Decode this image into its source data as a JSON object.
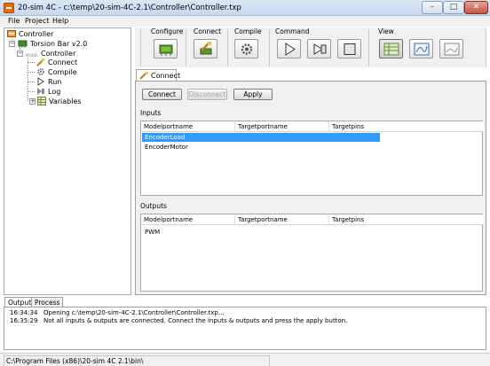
{
  "window": {
    "title": "20-sim 4C - c:\\temp\\20-sim-4C-2.1\\Controller\\Controller.txp",
    "minimize": "–",
    "maximize": "□",
    "close": "✕"
  },
  "menu": [
    "File",
    "Project",
    "Help"
  ],
  "tree": {
    "root": "Controller",
    "target": "Torsion Bar v2.0",
    "model": "Controller",
    "steps": [
      "Connect",
      "Compile",
      "Run",
      "Log",
      "Variables"
    ],
    "model_badge": "MODEL"
  },
  "toolbar": {
    "groups": [
      "Configure",
      "Connect",
      "Compile",
      "Command",
      "View"
    ]
  },
  "content": {
    "active_tab": "Connect",
    "buttons": {
      "connect": "Connect",
      "disconnect": "Disconnect",
      "apply": "Apply"
    },
    "inputs": {
      "label": "Inputs",
      "columns": [
        "Modelportname",
        "Targetportname",
        "Targetpins"
      ],
      "rows": [
        "EncoderLoad",
        "EncoderMotor"
      ]
    },
    "outputs": {
      "label": "Outputs",
      "columns": [
        "Modelportname",
        "Targetportname",
        "Targetpins"
      ],
      "rows": [
        "PWM"
      ]
    }
  },
  "output_panel": {
    "tabs": [
      "Output",
      "Process"
    ],
    "log": [
      {
        "time": "16:34:34",
        "msg": "Opening c:\\temp\\20-sim-4C-2.1\\Controller\\Controller.txp..."
      },
      {
        "time": "16:35:29",
        "msg": "Not all inputs & outputs are connected. Connect the inputs & outputs and press the apply button."
      }
    ]
  },
  "status": {
    "path": "C:\\Program Files (x86)\\20-sim 4C 2.1\\bin\\"
  },
  "colors": {
    "selection": "#3399ff",
    "accent_orange": "#e46c0a",
    "chip_green": "#4a8a2a"
  }
}
